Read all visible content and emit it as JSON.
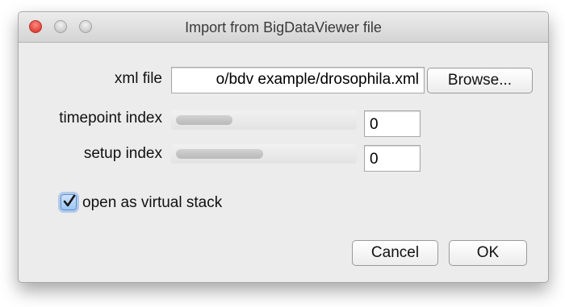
{
  "window": {
    "title": "Import from BigDataViewer file"
  },
  "form": {
    "xml_file": {
      "label": "xml file",
      "value": "o/bdv example/drosophila.xml",
      "browse_label": "Browse..."
    },
    "timepoint": {
      "label": "timepoint index",
      "value": "0",
      "slider_fraction": 0
    },
    "setup": {
      "label": "setup index",
      "value": "0",
      "slider_fraction": 0
    },
    "virtual_stack": {
      "label": "open as virtual stack",
      "checked": true
    }
  },
  "buttons": {
    "cancel_label": "Cancel",
    "ok_label": "OK"
  },
  "colors": {
    "close": "#e0443a",
    "checkbox_accent": "#5c8fd0"
  }
}
